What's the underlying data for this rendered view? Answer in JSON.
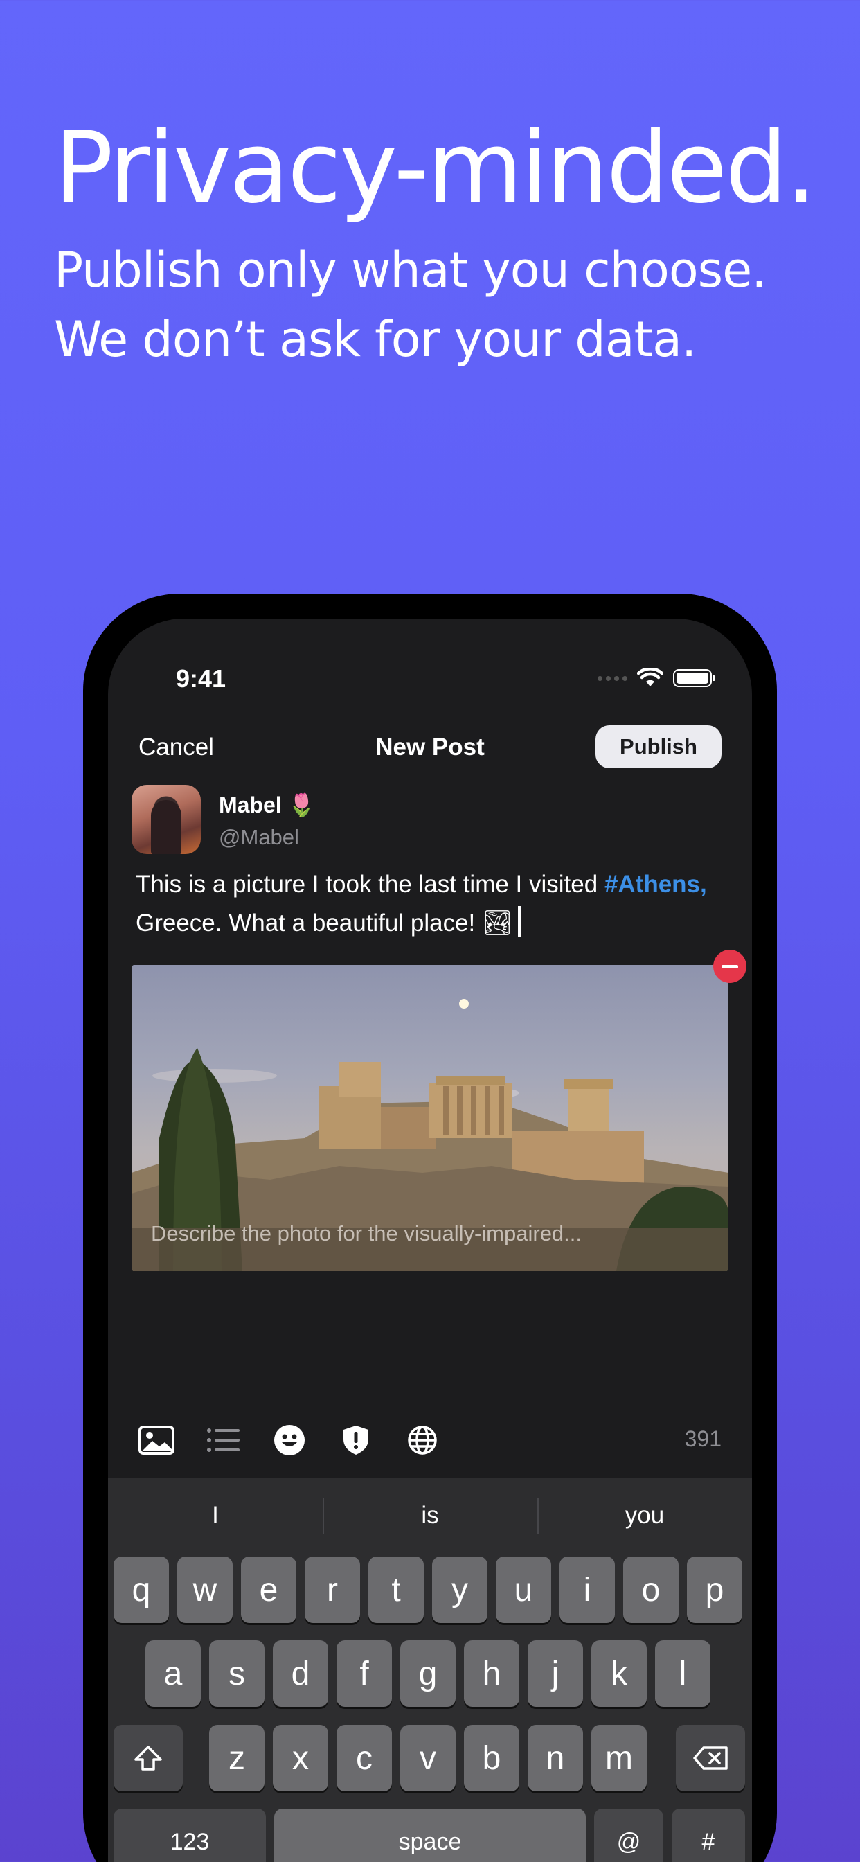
{
  "marketing": {
    "headline": "Privacy-minded.",
    "subline_1": "Publish only what you choose.",
    "subline_2": "We don’t ask for your data."
  },
  "status_bar": {
    "time": "9:41"
  },
  "navbar": {
    "cancel": "Cancel",
    "title": "New Post",
    "publish": "Publish"
  },
  "author": {
    "name": "Mabel 🌷",
    "handle": "@Mabel"
  },
  "post": {
    "text_part1": "This is a picture I took the last time I visited ",
    "hashtag": "#Athens,",
    "text_part2": " Greece. What a beautiful place! 🏞"
  },
  "attachment": {
    "alt_placeholder": "Describe the photo for the visually-impaired..."
  },
  "toolbar": {
    "icons": [
      "image-icon",
      "list-icon",
      "emoji-icon",
      "content-warning-icon",
      "globe-icon"
    ],
    "char_count": "391"
  },
  "keyboard": {
    "suggestions": [
      "I",
      "is",
      "you"
    ],
    "row1": [
      "q",
      "w",
      "e",
      "r",
      "t",
      "y",
      "u",
      "i",
      "o",
      "p"
    ],
    "row2": [
      "a",
      "s",
      "d",
      "f",
      "g",
      "h",
      "j",
      "k",
      "l"
    ],
    "row3": [
      "z",
      "x",
      "c",
      "v",
      "b",
      "n",
      "m"
    ],
    "numbers_key": "123",
    "space_key": "space",
    "at_key": "@",
    "hash_key": "#"
  },
  "colors": {
    "background": "#6366fb",
    "hashtag": "#3c8fe6",
    "remove": "#e5364a"
  }
}
